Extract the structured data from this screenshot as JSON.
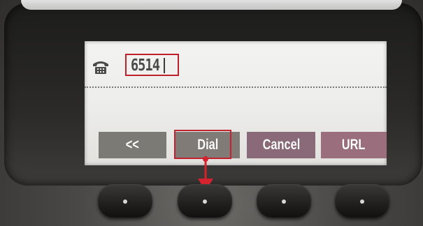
{
  "screen": {
    "dialed_number": "6514",
    "handset_icon": "handset-icon"
  },
  "softkeys": {
    "back_label": "<<",
    "dial_label": "Dial",
    "cancel_label": "Cancel",
    "url_label": "URL"
  },
  "annotations": {
    "highlight_color": "#c3232e",
    "highlighted_softkey": "Dial",
    "highlighted_field": "dialed_number"
  },
  "hardware": {
    "buttons": [
      "softkey-button-1",
      "softkey-button-2",
      "softkey-button-3",
      "softkey-button-4"
    ]
  },
  "colors": {
    "screen_bg": "#ececea",
    "softkey_grey": "#7b7a74",
    "softkey_pink": "#9a6e7c"
  }
}
